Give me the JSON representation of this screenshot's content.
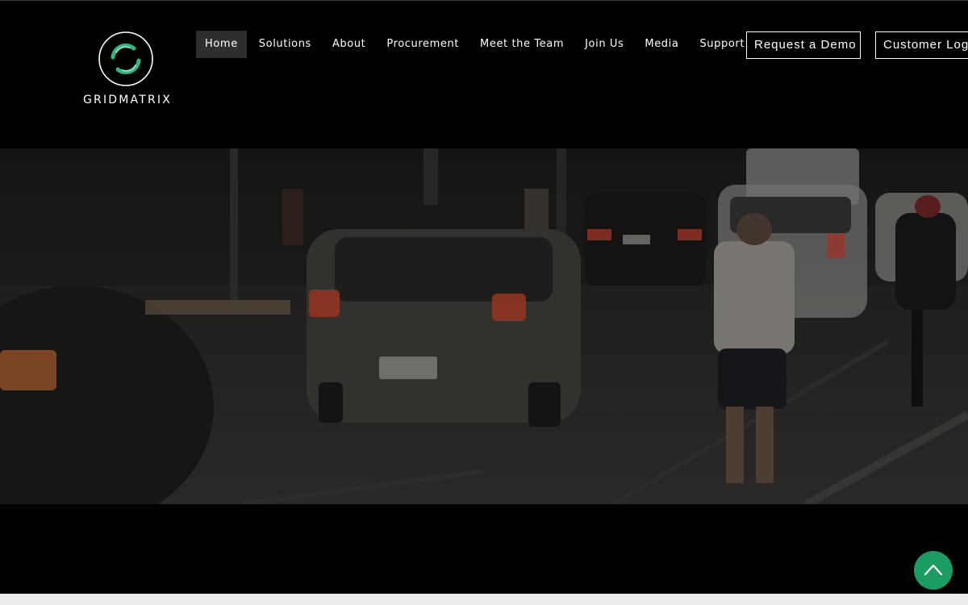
{
  "brand": {
    "name": "GRIDMATRIX",
    "logo_icon": "swirl-ring-logo",
    "accent_color": "#2fb58a"
  },
  "nav": {
    "items": [
      {
        "label": "Home",
        "active": true
      },
      {
        "label": "Solutions"
      },
      {
        "label": "About"
      },
      {
        "label": "Procurement"
      },
      {
        "label": "Meet the Team"
      },
      {
        "label": "Join Us"
      },
      {
        "label": "Media"
      },
      {
        "label": "Support"
      }
    ]
  },
  "actions": {
    "demo_label": "Request a Demo",
    "login_label": "Customer Login"
  },
  "hero": {
    "image": "night-street-traffic-photo"
  },
  "scroll_top": {
    "icon": "chevron-up-icon",
    "color": "#1a9c62"
  }
}
